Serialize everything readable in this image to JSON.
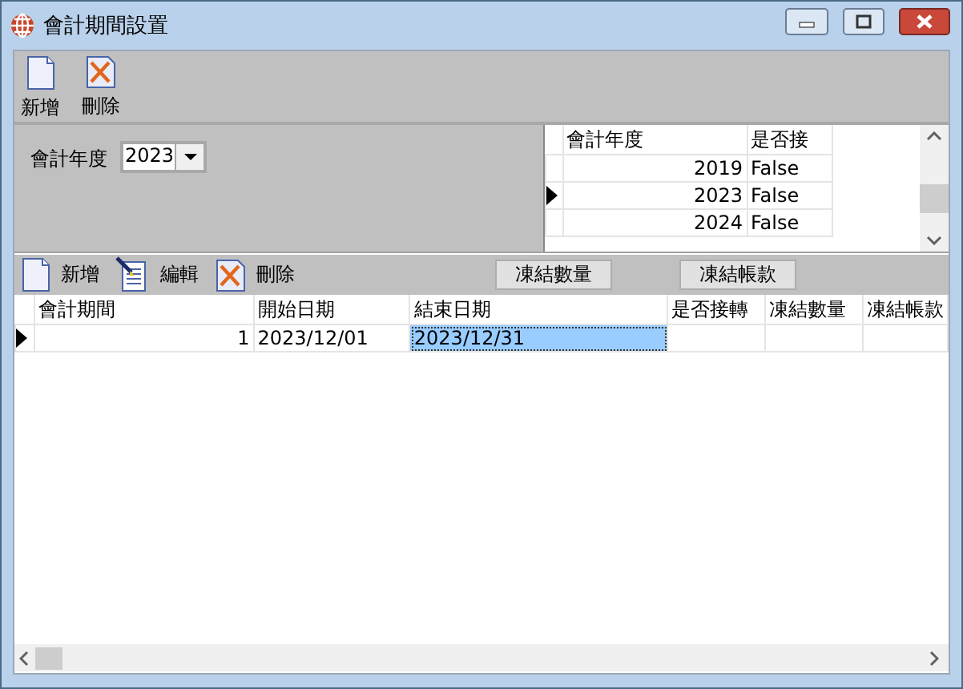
{
  "window": {
    "title": "會計期間設置"
  },
  "toolbar": [
    {
      "kind": "new",
      "label": "新增"
    },
    {
      "kind": "delete",
      "label": "刪除"
    }
  ],
  "filter": {
    "label": "會計年度",
    "value": "2023"
  },
  "year_grid": {
    "columns": [
      "會計年度",
      "是否接"
    ],
    "rows": [
      {
        "year": "2019",
        "carried": "False",
        "selected": false
      },
      {
        "year": "2023",
        "carried": "False",
        "selected": true
      },
      {
        "year": "2024",
        "carried": "False",
        "selected": false
      }
    ]
  },
  "period_toolbar": {
    "items": [
      {
        "kind": "new",
        "label": "新增"
      },
      {
        "kind": "edit",
        "label": "編輯"
      },
      {
        "kind": "delete",
        "label": "刪除"
      }
    ],
    "buttons": [
      "凍結數量",
      "凍結帳款"
    ]
  },
  "period_grid": {
    "columns": [
      "會計期間",
      "開始日期",
      "結束日期",
      "是否接轉",
      "凍結數量",
      "凍結帳款"
    ],
    "rows": [
      {
        "selected": true,
        "cells": [
          {
            "text": "1",
            "focused": false
          },
          {
            "text": "2023/12/01",
            "focused": false
          },
          {
            "text": "2023/12/31",
            "focused": true
          }
        ]
      }
    ]
  }
}
